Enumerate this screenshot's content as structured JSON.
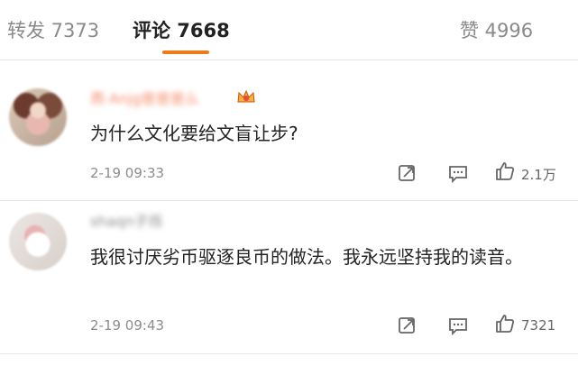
{
  "tabs": {
    "repost": "转发 7373",
    "comments": "评论 7668",
    "likes": "赞 4996"
  },
  "comments": [
    {
      "username": "燕·Anjg爸爸爸么",
      "text": "为什么文化要给文盲让步?",
      "time": "2-19 09:33",
      "likes": "2.1万"
    },
    {
      "username": "shaqn子烁",
      "text": "我很讨厌劣币驱逐良币的做法。我永远坚持我的读音。",
      "time": "2-19 09:43",
      "likes": "7321"
    }
  ],
  "colors": {
    "accent": "#f07a1a",
    "vip_username": "#f58b6a"
  },
  "icons": [
    "repost-icon",
    "comment-icon",
    "like-icon",
    "vip-crown-icon"
  ]
}
